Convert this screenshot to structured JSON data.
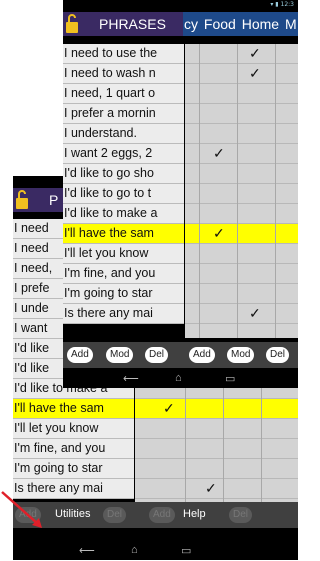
{
  "back": {
    "title": "P",
    "rows": [
      "I need",
      "I need",
      "I need,",
      "I prefe",
      "I unde",
      "I want",
      "I'd like",
      "I'd like",
      "I'd like to make a",
      "I'll have the sam",
      "I'll let you know",
      "I'm fine, and you",
      "I'm going to star",
      "Is there any mai"
    ],
    "highlight_index": 9,
    "buttons": [
      "Add",
      "Mod",
      "Del",
      "Add",
      "Mod",
      "Del"
    ],
    "menu_utilities": "Utilities",
    "menu_help": "Help"
  },
  "front": {
    "title": "PHRASES",
    "columns": [
      "cy",
      "Food",
      "Home",
      "M"
    ],
    "rows": [
      "I need to use the",
      "I need to wash n",
      "I need, 1 quart o",
      "I prefer a mornin",
      "I understand.",
      "I want 2 eggs, 2",
      "I'd like to go sho",
      "I'd like to go to t",
      "I'd like to make a",
      "I'll have the sam",
      "I'll let you know",
      "I'm fine, and you",
      "I'm going to star",
      "Is there any mai"
    ],
    "highlight_index": 9,
    "checkmark": "✓",
    "buttons": [
      "Add",
      "Mod",
      "Del",
      "Add",
      "Mod",
      "Del"
    ]
  },
  "colors": {
    "title_bar": "#3a2a63",
    "col_bar": "#1e4a8a",
    "highlight": "#ffff00",
    "arrow": "#e0202a"
  }
}
